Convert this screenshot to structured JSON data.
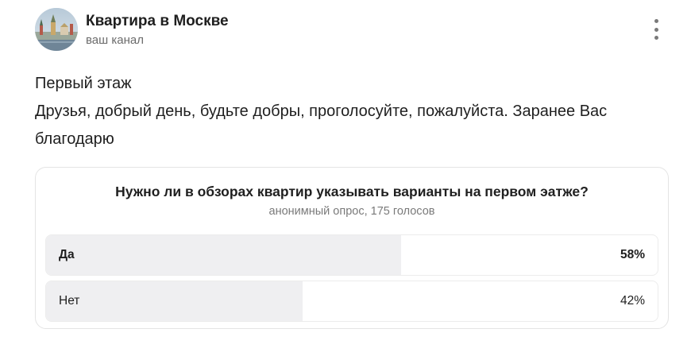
{
  "channel": {
    "name": "Квартира в Москве",
    "subtitle": "ваш канал",
    "avatar_icon": "kremlin-photo"
  },
  "post": {
    "lines": [
      "Первый этаж",
      "Друзья, добрый день, будьте добры, проголосуйте, пожалуйста. Заранее Вас",
      "благодарю"
    ]
  },
  "poll": {
    "question": "Нужно ли в обзорах квартир указывать варианты на первом эатже?",
    "meta": "анонимный опрос, 175 голосов",
    "options": [
      {
        "label": "Да",
        "percent_text": "58%",
        "share": 0.58,
        "leading": true
      },
      {
        "label": "Нет",
        "percent_text": "42%",
        "share": 0.42,
        "leading": false
      }
    ]
  },
  "colors": {
    "bar_fill": "#efeff1",
    "border": "#e4e4e4",
    "muted_text": "#7a7a7a"
  }
}
